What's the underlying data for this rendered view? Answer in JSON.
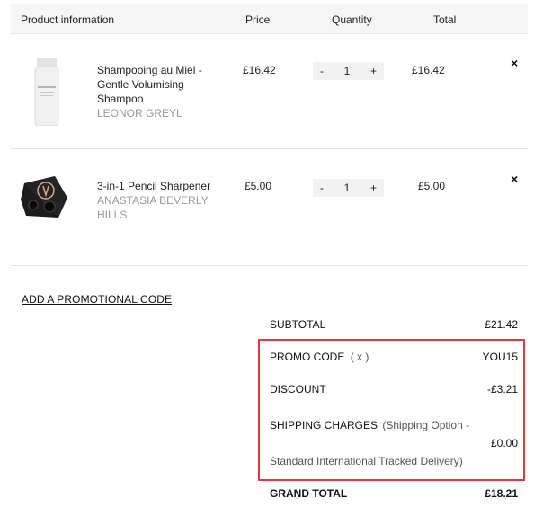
{
  "header": {
    "product_info": "Product information",
    "price": "Price",
    "quantity": "Quantity",
    "total": "Total"
  },
  "items": [
    {
      "name": "Shampooing au Miel - Gentle Volumising Shampoo",
      "brand": "LEONOR GREYL",
      "image_label": "Leonor Greyl",
      "price": "£16.42",
      "qty_minus": "-",
      "qty": "1",
      "qty_plus": "+",
      "total": "£16.42",
      "remove": "×"
    },
    {
      "name": "3-in-1 Pencil Sharpener",
      "brand": "ANASTASIA BEVERLY HILLS",
      "price": "£5.00",
      "qty_minus": "-",
      "qty": "1",
      "qty_plus": "+",
      "total": "£5.00",
      "remove": "×"
    }
  ],
  "promo_link": "ADD A PROMOTIONAL CODE",
  "summary": {
    "subtotal_label": "SUBTOTAL",
    "subtotal_value": "£21.42",
    "promo_label": "PROMO CODE",
    "promo_remove": "( x )",
    "promo_value": "YOU15",
    "discount_label": "DISCOUNT",
    "discount_value": "-£3.21",
    "shipping_label": "SHIPPING CHARGES",
    "shipping_detail_1": "(Shipping Option -",
    "shipping_detail_2": "Standard International Tracked Delivery)",
    "shipping_value": "£0.00",
    "grand_total_label": "GRAND TOTAL",
    "grand_total_value": "£18.21"
  },
  "colors": {
    "highlight": "#e2383f",
    "header_bg": "#f6f6f6",
    "brand_text": "#999999"
  }
}
